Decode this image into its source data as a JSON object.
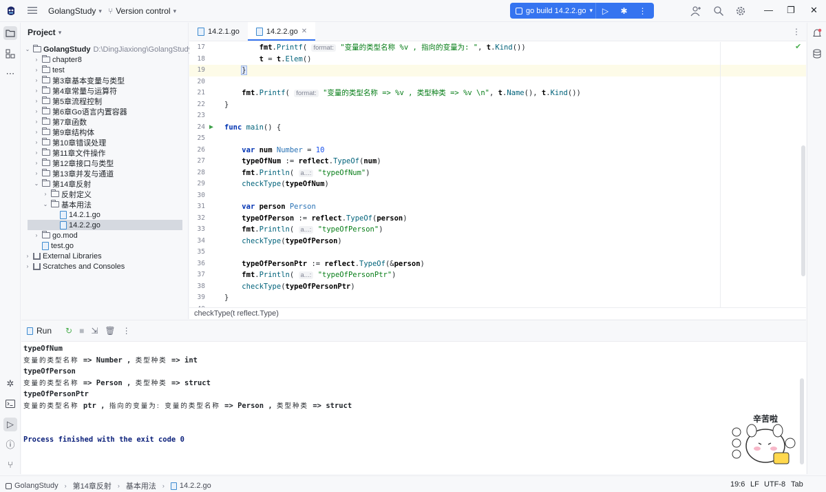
{
  "titlebar": {
    "project_name": "GolangStudy",
    "vcs_label": "Version control",
    "run_config": "go build 14.2.2.go"
  },
  "project_panel": {
    "title": "Project",
    "tree": [
      {
        "label": "GolangStudy",
        "extra": "D:\\DingJiaxiong\\GolangStudy",
        "depth": 0,
        "type": "folder",
        "expanded": true
      },
      {
        "label": "chapter8",
        "depth": 1,
        "type": "folder",
        "expanded": false
      },
      {
        "label": "test",
        "depth": 1,
        "type": "folder",
        "expanded": false
      },
      {
        "label": "第3章基本变量与类型",
        "depth": 1,
        "type": "folder",
        "expanded": false
      },
      {
        "label": "第4章常量与运算符",
        "depth": 1,
        "type": "folder",
        "expanded": false
      },
      {
        "label": "第5章流程控制",
        "depth": 1,
        "type": "folder",
        "expanded": false
      },
      {
        "label": "第6章Go语言内置容器",
        "depth": 1,
        "type": "folder",
        "expanded": false
      },
      {
        "label": "第7章函数",
        "depth": 1,
        "type": "folder",
        "expanded": false
      },
      {
        "label": "第9章结构体",
        "depth": 1,
        "type": "folder",
        "expanded": false
      },
      {
        "label": "第10章错误处理",
        "depth": 1,
        "type": "folder",
        "expanded": false
      },
      {
        "label": "第11章文件操作",
        "depth": 1,
        "type": "folder",
        "expanded": false
      },
      {
        "label": "第12章接口与类型",
        "depth": 1,
        "type": "folder",
        "expanded": false
      },
      {
        "label": "第13章并发与通道",
        "depth": 1,
        "type": "folder",
        "expanded": false
      },
      {
        "label": "第14章反射",
        "depth": 1,
        "type": "folder",
        "expanded": true
      },
      {
        "label": "反射定义",
        "depth": 2,
        "type": "folder",
        "expanded": false
      },
      {
        "label": "基本用法",
        "depth": 2,
        "type": "folder",
        "expanded": true
      },
      {
        "label": "14.2.1.go",
        "depth": 3,
        "type": "gofile"
      },
      {
        "label": "14.2.2.go",
        "depth": 3,
        "type": "gofile",
        "selected": true
      },
      {
        "label": "go.mod",
        "depth": 1,
        "type": "folder",
        "expanded": false
      },
      {
        "label": "test.go",
        "depth": 1,
        "type": "gofile"
      },
      {
        "label": "External Libraries",
        "depth": 0,
        "type": "lib",
        "expanded": false
      },
      {
        "label": "Scratches and Consoles",
        "depth": 0,
        "type": "scratch",
        "expanded": false
      }
    ]
  },
  "editor": {
    "tabs": [
      {
        "label": "14.2.1.go",
        "active": false
      },
      {
        "label": "14.2.2.go",
        "active": true
      }
    ],
    "breadcrumb": "checkType(t reflect.Type)",
    "lines": [
      {
        "n": "17",
        "html": "        <span class='pkg'>fmt</span>.<span class='call'>Printf</span>( <span class='hint'>format:</span> <span class='str'>\"变量的类型名称 %v , 指向的变量为: \"</span>, <span class='pkg'>t</span>.<span class='call'>Kind</span>())"
      },
      {
        "n": "18",
        "html": "        <span class='pkg'>t</span> = <span class='pkg'>t</span>.<span class='call'>Elem</span>()"
      },
      {
        "n": "19",
        "html": "    <span class='brace-hl'>}</span>",
        "current": true
      },
      {
        "n": "20",
        "html": ""
      },
      {
        "n": "21",
        "html": "    <span class='pkg'>fmt</span>.<span class='call'>Printf</span>( <span class='hint'>format:</span> <span class='str'>\"变量的类型名称 => %v , 类型种类 => %v \\n\"</span>, <span class='pkg'>t</span>.<span class='call'>Name</span>(), <span class='pkg'>t</span>.<span class='call'>Kind</span>())"
      },
      {
        "n": "22",
        "html": "}"
      },
      {
        "n": "23",
        "html": ""
      },
      {
        "n": "24",
        "html": "<span class='kw'>func</span> <span class='fn'>main</span>() {",
        "run": true
      },
      {
        "n": "25",
        "html": ""
      },
      {
        "n": "26",
        "html": "    <span class='kw'>var</span> <span class='pkg'>num</span> <span class='ty'>Number</span> = <span class='num'>10</span>"
      },
      {
        "n": "27",
        "html": "    <span class='pkg'>typeOfNum</span> := <span class='pkg'>reflect</span>.<span class='call'>TypeOf</span>(<span class='pkg'>num</span>)"
      },
      {
        "n": "28",
        "html": "    <span class='pkg'>fmt</span>.<span class='call'>Println</span>( <span class='hint'>a...:</span> <span class='str'>\"typeOfNum\"</span>)"
      },
      {
        "n": "29",
        "html": "    <span class='call'>checkType</span>(<span class='pkg'>typeOfNum</span>)"
      },
      {
        "n": "30",
        "html": ""
      },
      {
        "n": "31",
        "html": "    <span class='kw'>var</span> <span class='pkg'>person</span> <span class='ty'>Person</span>"
      },
      {
        "n": "32",
        "html": "    <span class='pkg'>typeOfPerson</span> := <span class='pkg'>reflect</span>.<span class='call'>TypeOf</span>(<span class='pkg'>person</span>)"
      },
      {
        "n": "33",
        "html": "    <span class='pkg'>fmt</span>.<span class='call'>Println</span>( <span class='hint'>a...:</span> <span class='str'>\"typeOfPerson\"</span>)"
      },
      {
        "n": "34",
        "html": "    <span class='call'>checkType</span>(<span class='pkg'>typeOfPerson</span>)"
      },
      {
        "n": "35",
        "html": ""
      },
      {
        "n": "36",
        "html": "    <span class='pkg'>typeOfPersonPtr</span> := <span class='pkg'>reflect</span>.<span class='call'>TypeOf</span>(&amp;<span class='pkg'>person</span>)"
      },
      {
        "n": "37",
        "html": "    <span class='pkg'>fmt</span>.<span class='call'>Println</span>( <span class='hint'>a...:</span> <span class='str'>\"typeOfPersonPtr\"</span>)"
      },
      {
        "n": "38",
        "html": "    <span class='call'>checkType</span>(<span class='pkg'>typeOfPersonPtr</span>)"
      },
      {
        "n": "39",
        "html": "}"
      },
      {
        "n": "40",
        "html": ""
      }
    ]
  },
  "run_panel": {
    "title": "Run",
    "output": [
      {
        "text": "typeOfNum",
        "cjk": false
      },
      {
        "html": "<span class='cjk'>变量的类型名称</span> => Number , <span class='cjk'>类型种类</span> => int"
      },
      {
        "text": "typeOfPerson",
        "cjk": false
      },
      {
        "html": "<span class='cjk'>变量的类型名称</span> => Person , <span class='cjk'>类型种类</span> => struct"
      },
      {
        "text": "typeOfPersonPtr",
        "cjk": false
      },
      {
        "html": "<span class='cjk'>变量的类型名称</span> ptr , <span class='cjk'>指向的变量为:</span> <span class='cjk'>变量的类型名称</span> => Person , <span class='cjk'>类型种类</span> => struct"
      },
      {
        "text": "",
        "cjk": false
      },
      {
        "text": "",
        "cjk": false
      },
      {
        "text": "Process finished with the exit code 0",
        "exit": true
      }
    ],
    "sticker_text": "辛苦啦"
  },
  "statusbar": {
    "crumbs": [
      "GolangStudy",
      "第14章反射",
      "基本用法",
      "14.2.2.go"
    ],
    "position": "19:6",
    "line_sep": "LF",
    "encoding": "UTF-8",
    "indent": "Tab"
  }
}
